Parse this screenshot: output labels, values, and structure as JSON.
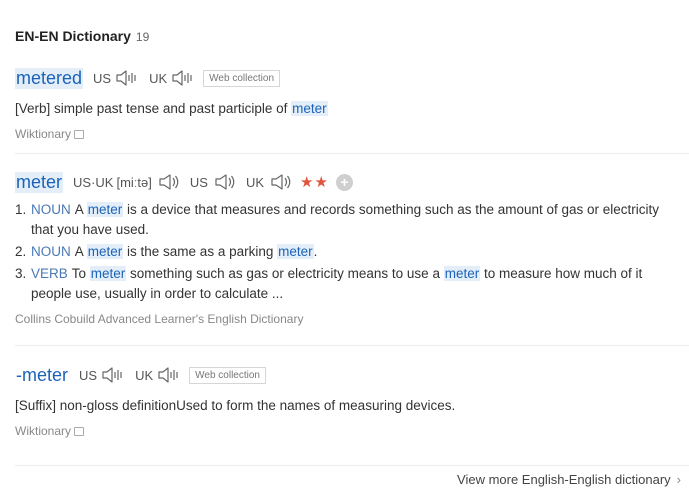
{
  "header": {
    "title": "EN-EN Dictionary",
    "count": "19"
  },
  "entries": [
    {
      "word": "metered",
      "us_label": "US",
      "uk_label": "UK",
      "badge": "Web collection",
      "def_tag": "[Verb]",
      "def_text": " simple past tense and past participle of ",
      "def_link": "meter",
      "source": "Wiktionary"
    },
    {
      "word": "meter",
      "us_uk_label": "US·UK",
      "ipa": "[miːtə]",
      "us_label": "US",
      "uk_label": "UK",
      "stars": "★★",
      "plus": "+",
      "senses": [
        {
          "num": "1.",
          "pos": "NOUN",
          "parts": [
            "A ",
            "meter",
            " is a device that measures and records something such as the amount of gas or electricity that you have used."
          ]
        },
        {
          "num": "2.",
          "pos": "NOUN",
          "parts": [
            "A ",
            "meter",
            " is the same as a parking ",
            "meter",
            "."
          ]
        },
        {
          "num": "3.",
          "pos": "VERB",
          "parts": [
            "To ",
            "meter",
            " something such as gas or electricity means to use a ",
            "meter",
            " to measure how much of it people use, usually in order to calculate ..."
          ]
        }
      ],
      "source": "Collins Cobuild Advanced Learner's English Dictionary"
    },
    {
      "word": "-meter",
      "us_label": "US",
      "uk_label": "UK",
      "badge": "Web collection",
      "def_tag": "[Suffix]",
      "def_text": " non-gloss definitionUsed to form the names of measuring devices.",
      "source": "Wiktionary"
    }
  ],
  "footer": {
    "link": "View more English-English dictionary",
    "chevron": "›"
  },
  "colors": {
    "link_blue": "#1b63b8",
    "highlight": "#e3eef9",
    "star_red": "#e0553e"
  }
}
